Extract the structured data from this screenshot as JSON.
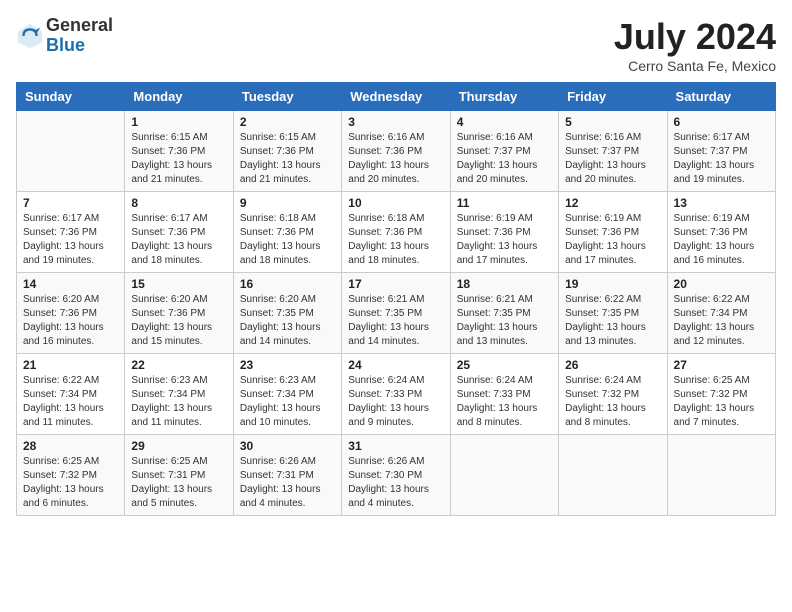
{
  "header": {
    "logo_line1": "General",
    "logo_line2": "Blue",
    "month_title": "July 2024",
    "location": "Cerro Santa Fe, Mexico"
  },
  "weekdays": [
    "Sunday",
    "Monday",
    "Tuesday",
    "Wednesday",
    "Thursday",
    "Friday",
    "Saturday"
  ],
  "weeks": [
    [
      {
        "day": "",
        "info": ""
      },
      {
        "day": "1",
        "info": "Sunrise: 6:15 AM\nSunset: 7:36 PM\nDaylight: 13 hours\nand 21 minutes."
      },
      {
        "day": "2",
        "info": "Sunrise: 6:15 AM\nSunset: 7:36 PM\nDaylight: 13 hours\nand 21 minutes."
      },
      {
        "day": "3",
        "info": "Sunrise: 6:16 AM\nSunset: 7:36 PM\nDaylight: 13 hours\nand 20 minutes."
      },
      {
        "day": "4",
        "info": "Sunrise: 6:16 AM\nSunset: 7:37 PM\nDaylight: 13 hours\nand 20 minutes."
      },
      {
        "day": "5",
        "info": "Sunrise: 6:16 AM\nSunset: 7:37 PM\nDaylight: 13 hours\nand 20 minutes."
      },
      {
        "day": "6",
        "info": "Sunrise: 6:17 AM\nSunset: 7:37 PM\nDaylight: 13 hours\nand 19 minutes."
      }
    ],
    [
      {
        "day": "7",
        "info": "Sunrise: 6:17 AM\nSunset: 7:36 PM\nDaylight: 13 hours\nand 19 minutes."
      },
      {
        "day": "8",
        "info": "Sunrise: 6:17 AM\nSunset: 7:36 PM\nDaylight: 13 hours\nand 18 minutes."
      },
      {
        "day": "9",
        "info": "Sunrise: 6:18 AM\nSunset: 7:36 PM\nDaylight: 13 hours\nand 18 minutes."
      },
      {
        "day": "10",
        "info": "Sunrise: 6:18 AM\nSunset: 7:36 PM\nDaylight: 13 hours\nand 18 minutes."
      },
      {
        "day": "11",
        "info": "Sunrise: 6:19 AM\nSunset: 7:36 PM\nDaylight: 13 hours\nand 17 minutes."
      },
      {
        "day": "12",
        "info": "Sunrise: 6:19 AM\nSunset: 7:36 PM\nDaylight: 13 hours\nand 17 minutes."
      },
      {
        "day": "13",
        "info": "Sunrise: 6:19 AM\nSunset: 7:36 PM\nDaylight: 13 hours\nand 16 minutes."
      }
    ],
    [
      {
        "day": "14",
        "info": "Sunrise: 6:20 AM\nSunset: 7:36 PM\nDaylight: 13 hours\nand 16 minutes."
      },
      {
        "day": "15",
        "info": "Sunrise: 6:20 AM\nSunset: 7:36 PM\nDaylight: 13 hours\nand 15 minutes."
      },
      {
        "day": "16",
        "info": "Sunrise: 6:20 AM\nSunset: 7:35 PM\nDaylight: 13 hours\nand 14 minutes."
      },
      {
        "day": "17",
        "info": "Sunrise: 6:21 AM\nSunset: 7:35 PM\nDaylight: 13 hours\nand 14 minutes."
      },
      {
        "day": "18",
        "info": "Sunrise: 6:21 AM\nSunset: 7:35 PM\nDaylight: 13 hours\nand 13 minutes."
      },
      {
        "day": "19",
        "info": "Sunrise: 6:22 AM\nSunset: 7:35 PM\nDaylight: 13 hours\nand 13 minutes."
      },
      {
        "day": "20",
        "info": "Sunrise: 6:22 AM\nSunset: 7:34 PM\nDaylight: 13 hours\nand 12 minutes."
      }
    ],
    [
      {
        "day": "21",
        "info": "Sunrise: 6:22 AM\nSunset: 7:34 PM\nDaylight: 13 hours\nand 11 minutes."
      },
      {
        "day": "22",
        "info": "Sunrise: 6:23 AM\nSunset: 7:34 PM\nDaylight: 13 hours\nand 11 minutes."
      },
      {
        "day": "23",
        "info": "Sunrise: 6:23 AM\nSunset: 7:34 PM\nDaylight: 13 hours\nand 10 minutes."
      },
      {
        "day": "24",
        "info": "Sunrise: 6:24 AM\nSunset: 7:33 PM\nDaylight: 13 hours\nand 9 minutes."
      },
      {
        "day": "25",
        "info": "Sunrise: 6:24 AM\nSunset: 7:33 PM\nDaylight: 13 hours\nand 8 minutes."
      },
      {
        "day": "26",
        "info": "Sunrise: 6:24 AM\nSunset: 7:32 PM\nDaylight: 13 hours\nand 8 minutes."
      },
      {
        "day": "27",
        "info": "Sunrise: 6:25 AM\nSunset: 7:32 PM\nDaylight: 13 hours\nand 7 minutes."
      }
    ],
    [
      {
        "day": "28",
        "info": "Sunrise: 6:25 AM\nSunset: 7:32 PM\nDaylight: 13 hours\nand 6 minutes."
      },
      {
        "day": "29",
        "info": "Sunrise: 6:25 AM\nSunset: 7:31 PM\nDaylight: 13 hours\nand 5 minutes."
      },
      {
        "day": "30",
        "info": "Sunrise: 6:26 AM\nSunset: 7:31 PM\nDaylight: 13 hours\nand 4 minutes."
      },
      {
        "day": "31",
        "info": "Sunrise: 6:26 AM\nSunset: 7:30 PM\nDaylight: 13 hours\nand 4 minutes."
      },
      {
        "day": "",
        "info": ""
      },
      {
        "day": "",
        "info": ""
      },
      {
        "day": "",
        "info": ""
      }
    ]
  ]
}
